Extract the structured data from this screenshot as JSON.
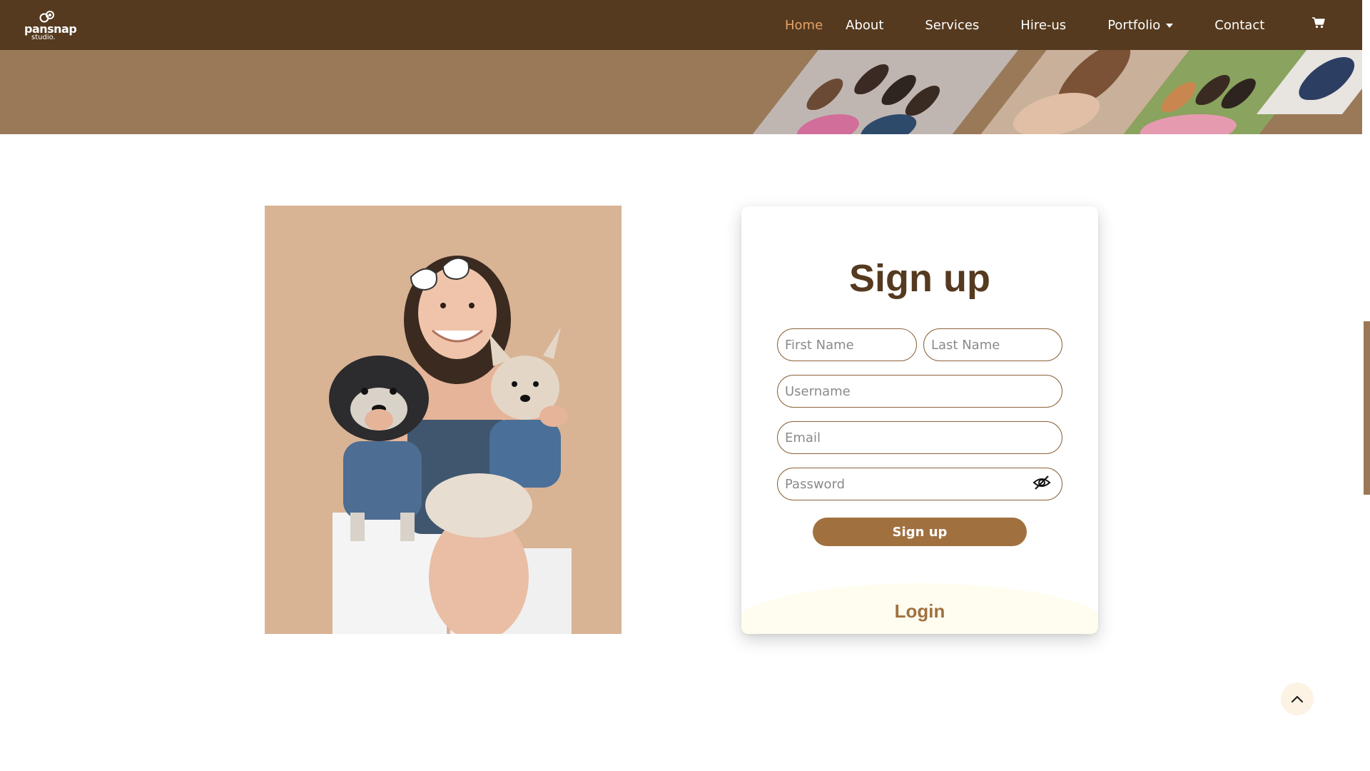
{
  "nav": {
    "logo_text": "pansnap",
    "logo_sub": "studio.",
    "items": [
      {
        "label": "Home",
        "active": true
      },
      {
        "label": "About"
      },
      {
        "label": "Services"
      },
      {
        "label": "Hire-us"
      },
      {
        "label": "Portfolio",
        "has_dropdown": true
      },
      {
        "label": "Contact"
      }
    ],
    "cart_icon": "cart-icon"
  },
  "form": {
    "title": "Sign up",
    "first_name_placeholder": "First Name",
    "last_name_placeholder": "Last Name",
    "username_placeholder": "Username",
    "email_placeholder": "Email",
    "password_placeholder": "Password",
    "password_toggle_icon": "eye-slash-icon",
    "submit_label": "Sign up",
    "login_label": "Login"
  },
  "colors": {
    "nav_bg": "#553a1f",
    "banner_bg": "#9a7958",
    "accent": "#a0713f",
    "active_link": "#e3a36a",
    "title": "#553a1f"
  },
  "back_to_top_icon": "chevron-up-icon"
}
